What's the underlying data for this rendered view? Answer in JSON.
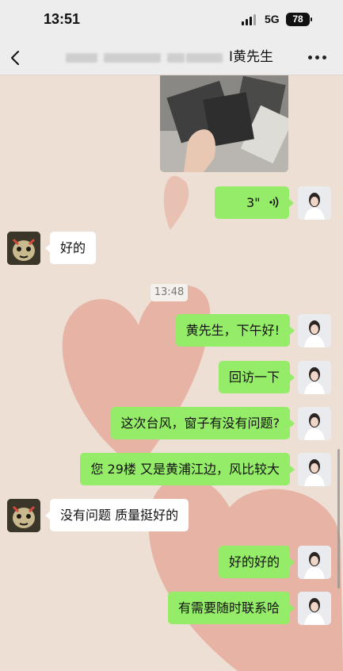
{
  "status_bar": {
    "time": "13:51",
    "network": "5G",
    "battery": "78"
  },
  "nav": {
    "title": "I黄先生",
    "back_icon": "chevron-left-icon",
    "more_icon": "more-dots-icon"
  },
  "messages": {
    "voice_duration": "3\"",
    "m1": "好的",
    "timestamp": "13:48",
    "m2": "黄先生，下午好!",
    "m3": "回访一下",
    "m4": "这次台风，窗子有没有问题?",
    "m5": "您 29楼  又是黄浦江边，风比较大",
    "m6": "没有问题 质量挺好的",
    "m7": "好的好的",
    "m8": "有需要随时联系哈"
  },
  "colors": {
    "my_bubble": "#95ec69",
    "other_bubble": "#ffffff",
    "chat_background": "#eedfd4",
    "heart": "#e3a293"
  }
}
